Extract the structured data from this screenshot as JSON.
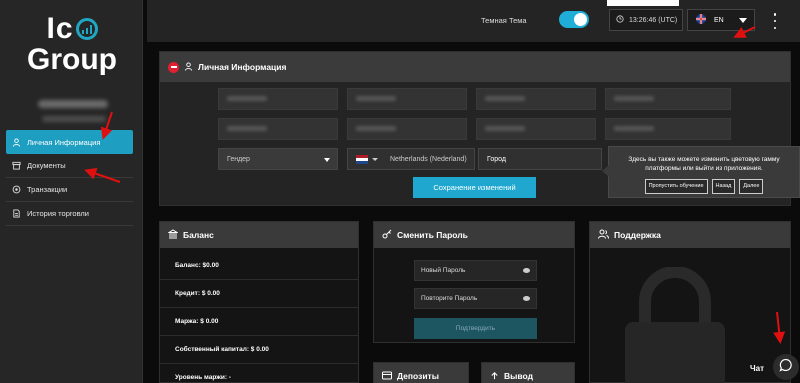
{
  "brand": {
    "line1": "Ic",
    "line2": "Group",
    "accent": "#1fa7c4"
  },
  "sidebar": {
    "items": [
      {
        "label": "Личная Информация",
        "icon": "user-icon",
        "active": true
      },
      {
        "label": "Документы",
        "icon": "archive-icon",
        "active": false
      },
      {
        "label": "Транзакции",
        "icon": "transactions-icon",
        "active": false
      },
      {
        "label": "История торговли",
        "icon": "document-icon",
        "active": false
      }
    ]
  },
  "topbar": {
    "theme_label": "Темная Тема",
    "clock": "13:26:46 (UTC)",
    "language": "EN"
  },
  "personal_info": {
    "title": "Личная Информация",
    "gender_placeholder": "Гендер",
    "country": "Netherlands (Nederland)",
    "city_placeholder": "Город",
    "save_label": "Сохранение изменений"
  },
  "onboarding": {
    "text": "Здесь вы также можете изменить цветовую гамму платформы или выйти из приложения.",
    "skip": "Пропустить обучение",
    "back": "Назад",
    "next": "Далее"
  },
  "balance": {
    "title": "Баланс",
    "rows": [
      "Баланс: $0.00",
      "Кредит: $ 0.00",
      "Маржа: $ 0.00",
      "Собственный капитал: $ 0.00",
      "Уровень маржи: -"
    ]
  },
  "password": {
    "title": "Сменить Пароль",
    "new_label": "Новый Пароль",
    "repeat_label": "Повторите Пароль",
    "confirm_label": "Подтвердить"
  },
  "support": {
    "title": "Поддержка"
  },
  "deposits": {
    "title": "Депозиты"
  },
  "withdraw": {
    "title": "Вывод"
  },
  "chat": {
    "label": "Чат"
  },
  "colors": {
    "accent": "#1fa7cf",
    "danger": "#e02030",
    "panel": "#242424",
    "annotation": "#e01010"
  }
}
